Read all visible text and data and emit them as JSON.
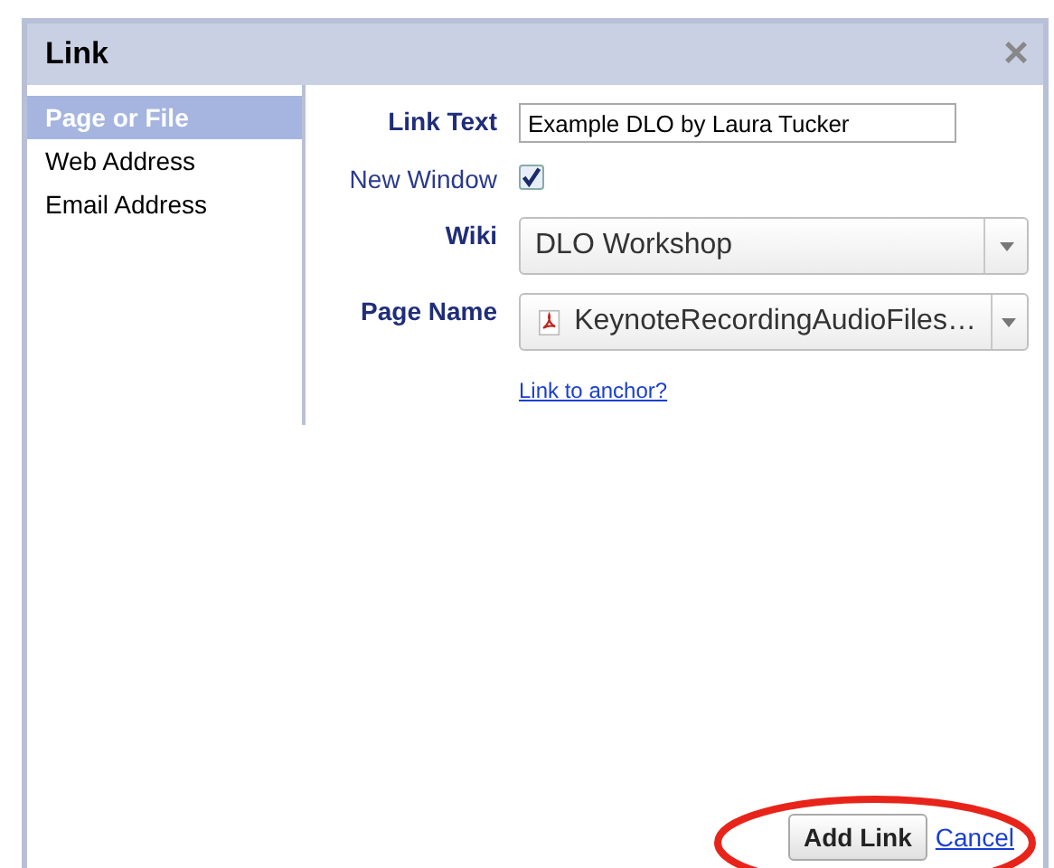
{
  "dialog": {
    "title": "Link",
    "close": "×"
  },
  "sidebar": {
    "items": [
      {
        "label": "Page or File",
        "selected": true
      },
      {
        "label": "Web Address",
        "selected": false
      },
      {
        "label": "Email Address",
        "selected": false
      }
    ]
  },
  "form": {
    "fields": [
      {
        "kind": "text",
        "label": "Link Text",
        "value": "Example DLO by Laura Tucker"
      },
      {
        "kind": "checkbox",
        "label": "New Window",
        "checked": true
      },
      {
        "kind": "select",
        "label": "Wiki",
        "value": "DLO Workshop"
      },
      {
        "kind": "file-select",
        "label": "Page Name",
        "value": "KeynoteRecordingAudioFiles…"
      }
    ],
    "link": "Link to anchor?"
  },
  "footer": {
    "primary": "Add Link",
    "secondary": "Cancel",
    "highlighted": true
  }
}
